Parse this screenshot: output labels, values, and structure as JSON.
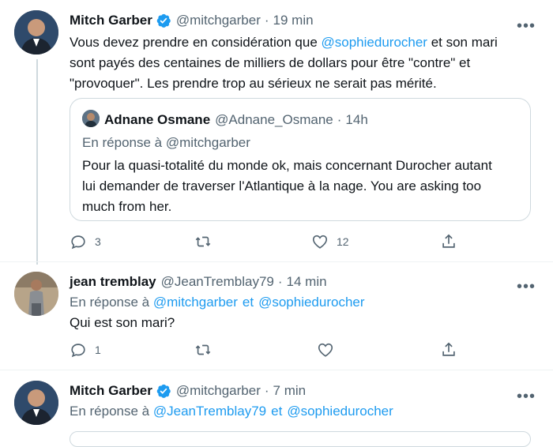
{
  "tweets": [
    {
      "name": "Mitch Garber",
      "handle": "@mitchgarber",
      "time": "19 min",
      "text_parts": {
        "l1_a": "Vous devez prendre en considération que ",
        "l1_mention": "@sophiedurocher",
        "l1_b": " et son mari",
        "l2": "sont payés des centaines de milliers de dollars pour être \"contre\" et",
        "l3": "\"provoquer\". Les prendre trop au sérieux ne serait pas mérité."
      },
      "quote": {
        "name": "Adnane Osmane",
        "handle": "@Adnane_Osmane",
        "time": "14h",
        "reply_prefix": "En réponse à",
        "reply_handle": "@mitchgarber",
        "l1": "Pour la quasi-totalité du monde ok, mais concernant Durocher autant",
        "l2": "lui demander de traverser l'Atlantique à la nage. You are asking too",
        "l3": "much from her."
      },
      "replies": "3",
      "retweets": "",
      "likes": "12"
    },
    {
      "name": "jean tremblay",
      "handle": "@JeanTremblay79",
      "time": "14 min",
      "reply_prefix": "En réponse à",
      "reply_handles": [
        "@mitchgarber",
        "@sophiedurocher"
      ],
      "reply_sep": "et",
      "text": "Qui est son mari?",
      "replies": "1",
      "retweets": "",
      "likes": ""
    },
    {
      "name": "Mitch Garber",
      "handle": "@mitchgarber",
      "time": "7 min",
      "reply_prefix": "En réponse à",
      "reply_handles": [
        "@JeanTremblay79",
        "@sophiedurocher"
      ],
      "reply_sep": "et"
    }
  ],
  "dot": "·",
  "more": "•••",
  "colors": {
    "accent": "#1d9bf0",
    "muted": "#536471",
    "border": "#cfd9de"
  },
  "icons": [
    "verified-badge-icon",
    "more-icon",
    "reply-icon",
    "retweet-icon",
    "like-icon",
    "share-icon"
  ]
}
